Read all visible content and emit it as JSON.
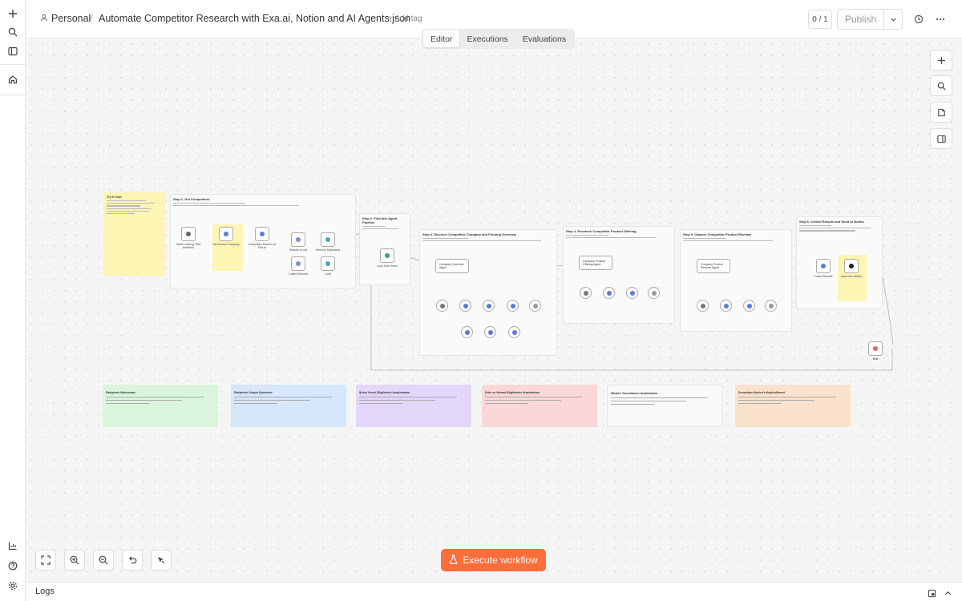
{
  "header": {
    "workspace": "Personal",
    "separator": "/",
    "workflow_name": "Automate Competitor Research with Exa.ai, Notion and AI Agents.json",
    "add_tag": "+ Add tag",
    "counter": "0 / 1",
    "publish_label": "Publish"
  },
  "tabs": [
    {
      "label": "Editor",
      "active": true
    },
    {
      "label": "Executions",
      "active": false
    },
    {
      "label": "Evaluations",
      "active": false
    }
  ],
  "canvas": {
    "execute_label": "Execute workflow",
    "accent": "#ff6d3a"
  },
  "workflow": {
    "stickies": [
      {
        "title": "Try It Out!",
        "color": "#fdf5b3"
      },
      {
        "title": "Step 1. Get Competitors",
        "color": "#fafafa"
      },
      {
        "title": "Step 2. Find Into Agent Pipeline",
        "color": "#fafafa"
      },
      {
        "title": "Step 3. Discover Competitor Company and Funding Overview",
        "color": "#fafafa"
      },
      {
        "title": "Step 4. Research Competitor Product Offering",
        "color": "#fafafa"
      },
      {
        "title": "Step 5. Capture Competitor Product Reviews",
        "color": "#fafafa"
      },
      {
        "title": "Step 6. Collect Results and Send to Notion",
        "color": "#fafafa"
      }
    ],
    "nodes": [
      "When clicking 'Test workflow'",
      "Set Source Company",
      "Competitor Search via Exa.ai",
      "Results to List",
      "Remove Duplicates",
      "Collect Domain",
      "Limit",
      "Loop Over Items",
      "Company Overview Agent",
      "Company Product Offering Agent",
      "Company Product Reviews Agent",
      "Collect Results",
      "Insert into Notion",
      "Wait"
    ]
  },
  "notes": [
    {
      "title": "Rakiplerin Bulunması",
      "color": "#d9f6dc"
    },
    {
      "title": "Rakiplerin Sırayla İşlenmesi",
      "color": "#d6e6fb"
    },
    {
      "title": "Şirket Genel Bilgilerinin Araştırılması",
      "color": "#e3d6fb"
    },
    {
      "title": "Ürün ve Hizmet Bilgilerinin Araştırılması",
      "color": "#fbd8d8"
    },
    {
      "title": "Müşteri Yorumlarının Araştırılması",
      "color": "#fafafa"
    },
    {
      "title": "Sonuçların Notion'a Kaydedilmesi",
      "color": "#fbe2cd"
    }
  ],
  "footer": {
    "logs_label": "Logs"
  }
}
